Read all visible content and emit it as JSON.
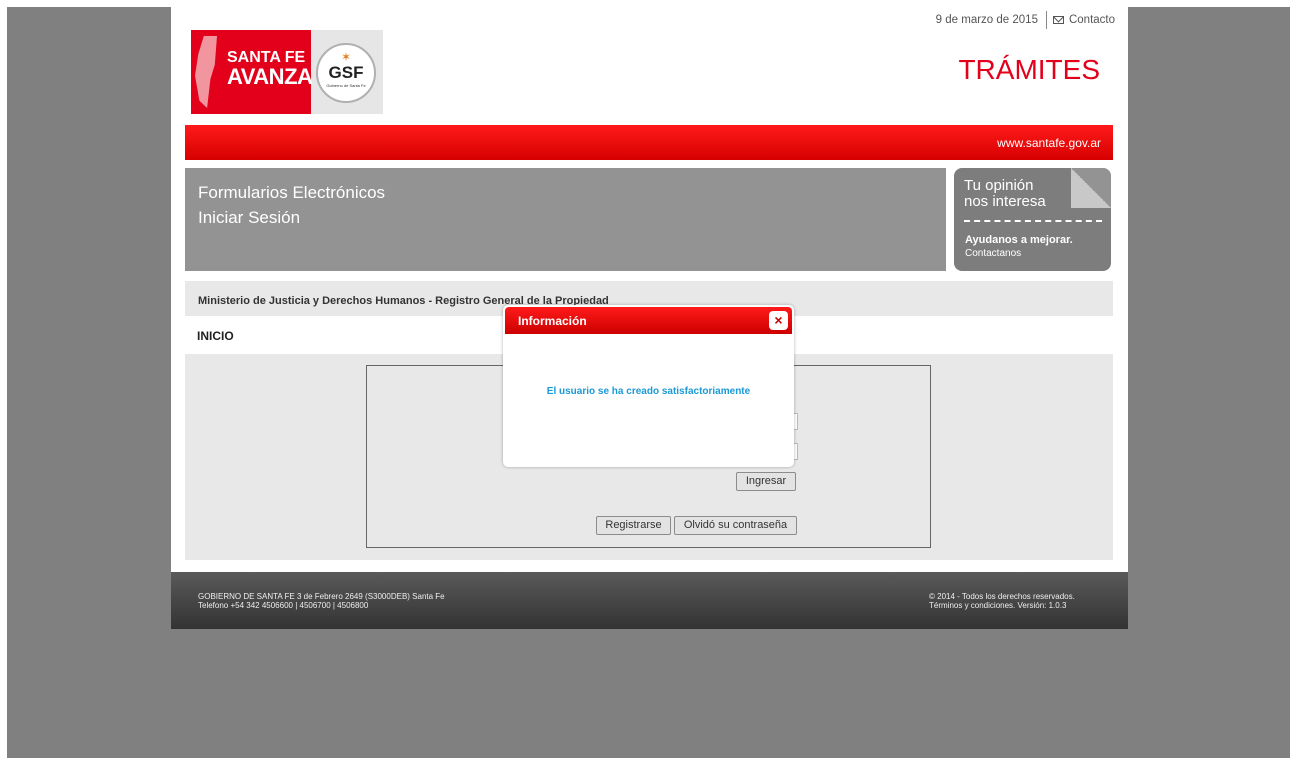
{
  "header": {
    "date": "9 de marzo de 2015",
    "contact_label": "Contacto",
    "section_title": "TRÁMITES",
    "url": "www.santafe.gov.ar"
  },
  "logo": {
    "line1": "SANTA FE",
    "line2": "AVANZA",
    "gsf": "GSF",
    "gsf_sub": "Gobierno de Santa Fe"
  },
  "banner": {
    "line1": "Formularios Electrónicos",
    "line2": "Iniciar Sesión"
  },
  "opinion": {
    "line1": "Tu opinión",
    "line2": "nos interesa",
    "cta": "Ayudanos a mejorar.",
    "sub": "Contactanos"
  },
  "ministerio": "Ministerio de Justicia y Derechos Humanos - Registro General de la Propiedad",
  "inicio": "INICIO",
  "login": {
    "ingresar_label": "Ingresar",
    "registrarse_label": "Registrarse",
    "olvido_label": "Olvidó su contraseña"
  },
  "footer": {
    "left_line1": "GOBIERNO DE SANTA FE 3 de Febrero 2649 (S3000DEB) Santa Fe",
    "left_line2": "Telefono +54 342 4506600 | 4506700 | 4506800",
    "right_line1": "© 2014 - Todos los derechos reservados.",
    "right_line2": "Términos y condiciones. Versión: 1.0.3"
  },
  "modal": {
    "title": "Información",
    "message": "El usuario se ha creado satisfactoriamente",
    "close_glyph": "×"
  },
  "colors": {
    "brand_red": "#e3001b",
    "message_blue": "#1a9ad6",
    "overlay_gray": "#808080"
  }
}
